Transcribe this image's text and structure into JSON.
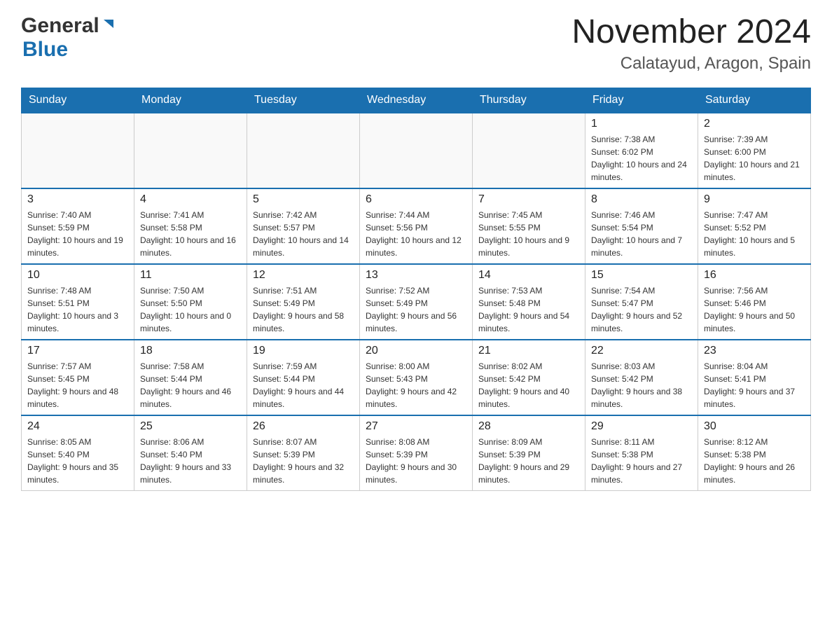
{
  "header": {
    "logo_general": "General",
    "logo_blue": "Blue",
    "month_title": "November 2024",
    "location": "Calatayud, Aragon, Spain"
  },
  "days_of_week": [
    "Sunday",
    "Monday",
    "Tuesday",
    "Wednesday",
    "Thursday",
    "Friday",
    "Saturday"
  ],
  "weeks": [
    [
      {
        "day": "",
        "sunrise": "",
        "sunset": "",
        "daylight": ""
      },
      {
        "day": "",
        "sunrise": "",
        "sunset": "",
        "daylight": ""
      },
      {
        "day": "",
        "sunrise": "",
        "sunset": "",
        "daylight": ""
      },
      {
        "day": "",
        "sunrise": "",
        "sunset": "",
        "daylight": ""
      },
      {
        "day": "",
        "sunrise": "",
        "sunset": "",
        "daylight": ""
      },
      {
        "day": "1",
        "sunrise": "Sunrise: 7:38 AM",
        "sunset": "Sunset: 6:02 PM",
        "daylight": "Daylight: 10 hours and 24 minutes."
      },
      {
        "day": "2",
        "sunrise": "Sunrise: 7:39 AM",
        "sunset": "Sunset: 6:00 PM",
        "daylight": "Daylight: 10 hours and 21 minutes."
      }
    ],
    [
      {
        "day": "3",
        "sunrise": "Sunrise: 7:40 AM",
        "sunset": "Sunset: 5:59 PM",
        "daylight": "Daylight: 10 hours and 19 minutes."
      },
      {
        "day": "4",
        "sunrise": "Sunrise: 7:41 AM",
        "sunset": "Sunset: 5:58 PM",
        "daylight": "Daylight: 10 hours and 16 minutes."
      },
      {
        "day": "5",
        "sunrise": "Sunrise: 7:42 AM",
        "sunset": "Sunset: 5:57 PM",
        "daylight": "Daylight: 10 hours and 14 minutes."
      },
      {
        "day": "6",
        "sunrise": "Sunrise: 7:44 AM",
        "sunset": "Sunset: 5:56 PM",
        "daylight": "Daylight: 10 hours and 12 minutes."
      },
      {
        "day": "7",
        "sunrise": "Sunrise: 7:45 AM",
        "sunset": "Sunset: 5:55 PM",
        "daylight": "Daylight: 10 hours and 9 minutes."
      },
      {
        "day": "8",
        "sunrise": "Sunrise: 7:46 AM",
        "sunset": "Sunset: 5:54 PM",
        "daylight": "Daylight: 10 hours and 7 minutes."
      },
      {
        "day": "9",
        "sunrise": "Sunrise: 7:47 AM",
        "sunset": "Sunset: 5:52 PM",
        "daylight": "Daylight: 10 hours and 5 minutes."
      }
    ],
    [
      {
        "day": "10",
        "sunrise": "Sunrise: 7:48 AM",
        "sunset": "Sunset: 5:51 PM",
        "daylight": "Daylight: 10 hours and 3 minutes."
      },
      {
        "day": "11",
        "sunrise": "Sunrise: 7:50 AM",
        "sunset": "Sunset: 5:50 PM",
        "daylight": "Daylight: 10 hours and 0 minutes."
      },
      {
        "day": "12",
        "sunrise": "Sunrise: 7:51 AM",
        "sunset": "Sunset: 5:49 PM",
        "daylight": "Daylight: 9 hours and 58 minutes."
      },
      {
        "day": "13",
        "sunrise": "Sunrise: 7:52 AM",
        "sunset": "Sunset: 5:49 PM",
        "daylight": "Daylight: 9 hours and 56 minutes."
      },
      {
        "day": "14",
        "sunrise": "Sunrise: 7:53 AM",
        "sunset": "Sunset: 5:48 PM",
        "daylight": "Daylight: 9 hours and 54 minutes."
      },
      {
        "day": "15",
        "sunrise": "Sunrise: 7:54 AM",
        "sunset": "Sunset: 5:47 PM",
        "daylight": "Daylight: 9 hours and 52 minutes."
      },
      {
        "day": "16",
        "sunrise": "Sunrise: 7:56 AM",
        "sunset": "Sunset: 5:46 PM",
        "daylight": "Daylight: 9 hours and 50 minutes."
      }
    ],
    [
      {
        "day": "17",
        "sunrise": "Sunrise: 7:57 AM",
        "sunset": "Sunset: 5:45 PM",
        "daylight": "Daylight: 9 hours and 48 minutes."
      },
      {
        "day": "18",
        "sunrise": "Sunrise: 7:58 AM",
        "sunset": "Sunset: 5:44 PM",
        "daylight": "Daylight: 9 hours and 46 minutes."
      },
      {
        "day": "19",
        "sunrise": "Sunrise: 7:59 AM",
        "sunset": "Sunset: 5:44 PM",
        "daylight": "Daylight: 9 hours and 44 minutes."
      },
      {
        "day": "20",
        "sunrise": "Sunrise: 8:00 AM",
        "sunset": "Sunset: 5:43 PM",
        "daylight": "Daylight: 9 hours and 42 minutes."
      },
      {
        "day": "21",
        "sunrise": "Sunrise: 8:02 AM",
        "sunset": "Sunset: 5:42 PM",
        "daylight": "Daylight: 9 hours and 40 minutes."
      },
      {
        "day": "22",
        "sunrise": "Sunrise: 8:03 AM",
        "sunset": "Sunset: 5:42 PM",
        "daylight": "Daylight: 9 hours and 38 minutes."
      },
      {
        "day": "23",
        "sunrise": "Sunrise: 8:04 AM",
        "sunset": "Sunset: 5:41 PM",
        "daylight": "Daylight: 9 hours and 37 minutes."
      }
    ],
    [
      {
        "day": "24",
        "sunrise": "Sunrise: 8:05 AM",
        "sunset": "Sunset: 5:40 PM",
        "daylight": "Daylight: 9 hours and 35 minutes."
      },
      {
        "day": "25",
        "sunrise": "Sunrise: 8:06 AM",
        "sunset": "Sunset: 5:40 PM",
        "daylight": "Daylight: 9 hours and 33 minutes."
      },
      {
        "day": "26",
        "sunrise": "Sunrise: 8:07 AM",
        "sunset": "Sunset: 5:39 PM",
        "daylight": "Daylight: 9 hours and 32 minutes."
      },
      {
        "day": "27",
        "sunrise": "Sunrise: 8:08 AM",
        "sunset": "Sunset: 5:39 PM",
        "daylight": "Daylight: 9 hours and 30 minutes."
      },
      {
        "day": "28",
        "sunrise": "Sunrise: 8:09 AM",
        "sunset": "Sunset: 5:39 PM",
        "daylight": "Daylight: 9 hours and 29 minutes."
      },
      {
        "day": "29",
        "sunrise": "Sunrise: 8:11 AM",
        "sunset": "Sunset: 5:38 PM",
        "daylight": "Daylight: 9 hours and 27 minutes."
      },
      {
        "day": "30",
        "sunrise": "Sunrise: 8:12 AM",
        "sunset": "Sunset: 5:38 PM",
        "daylight": "Daylight: 9 hours and 26 minutes."
      }
    ]
  ]
}
